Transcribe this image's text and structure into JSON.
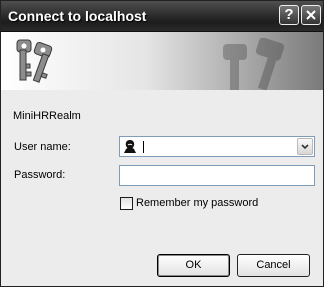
{
  "window": {
    "title": "Connect to localhost",
    "help_button": "?"
  },
  "form": {
    "realm": "MiniHRRealm",
    "username_label": "User name:",
    "username_value": "",
    "password_label": "Password:",
    "password_value": "",
    "remember_label": "Remember my password",
    "remember_checked": false
  },
  "buttons": {
    "ok": "OK",
    "cancel": "Cancel"
  },
  "icons": {
    "banner": "keys-icon",
    "user_field": "user-icon",
    "dropdown": "chevron-down-icon",
    "close": "close-icon"
  }
}
